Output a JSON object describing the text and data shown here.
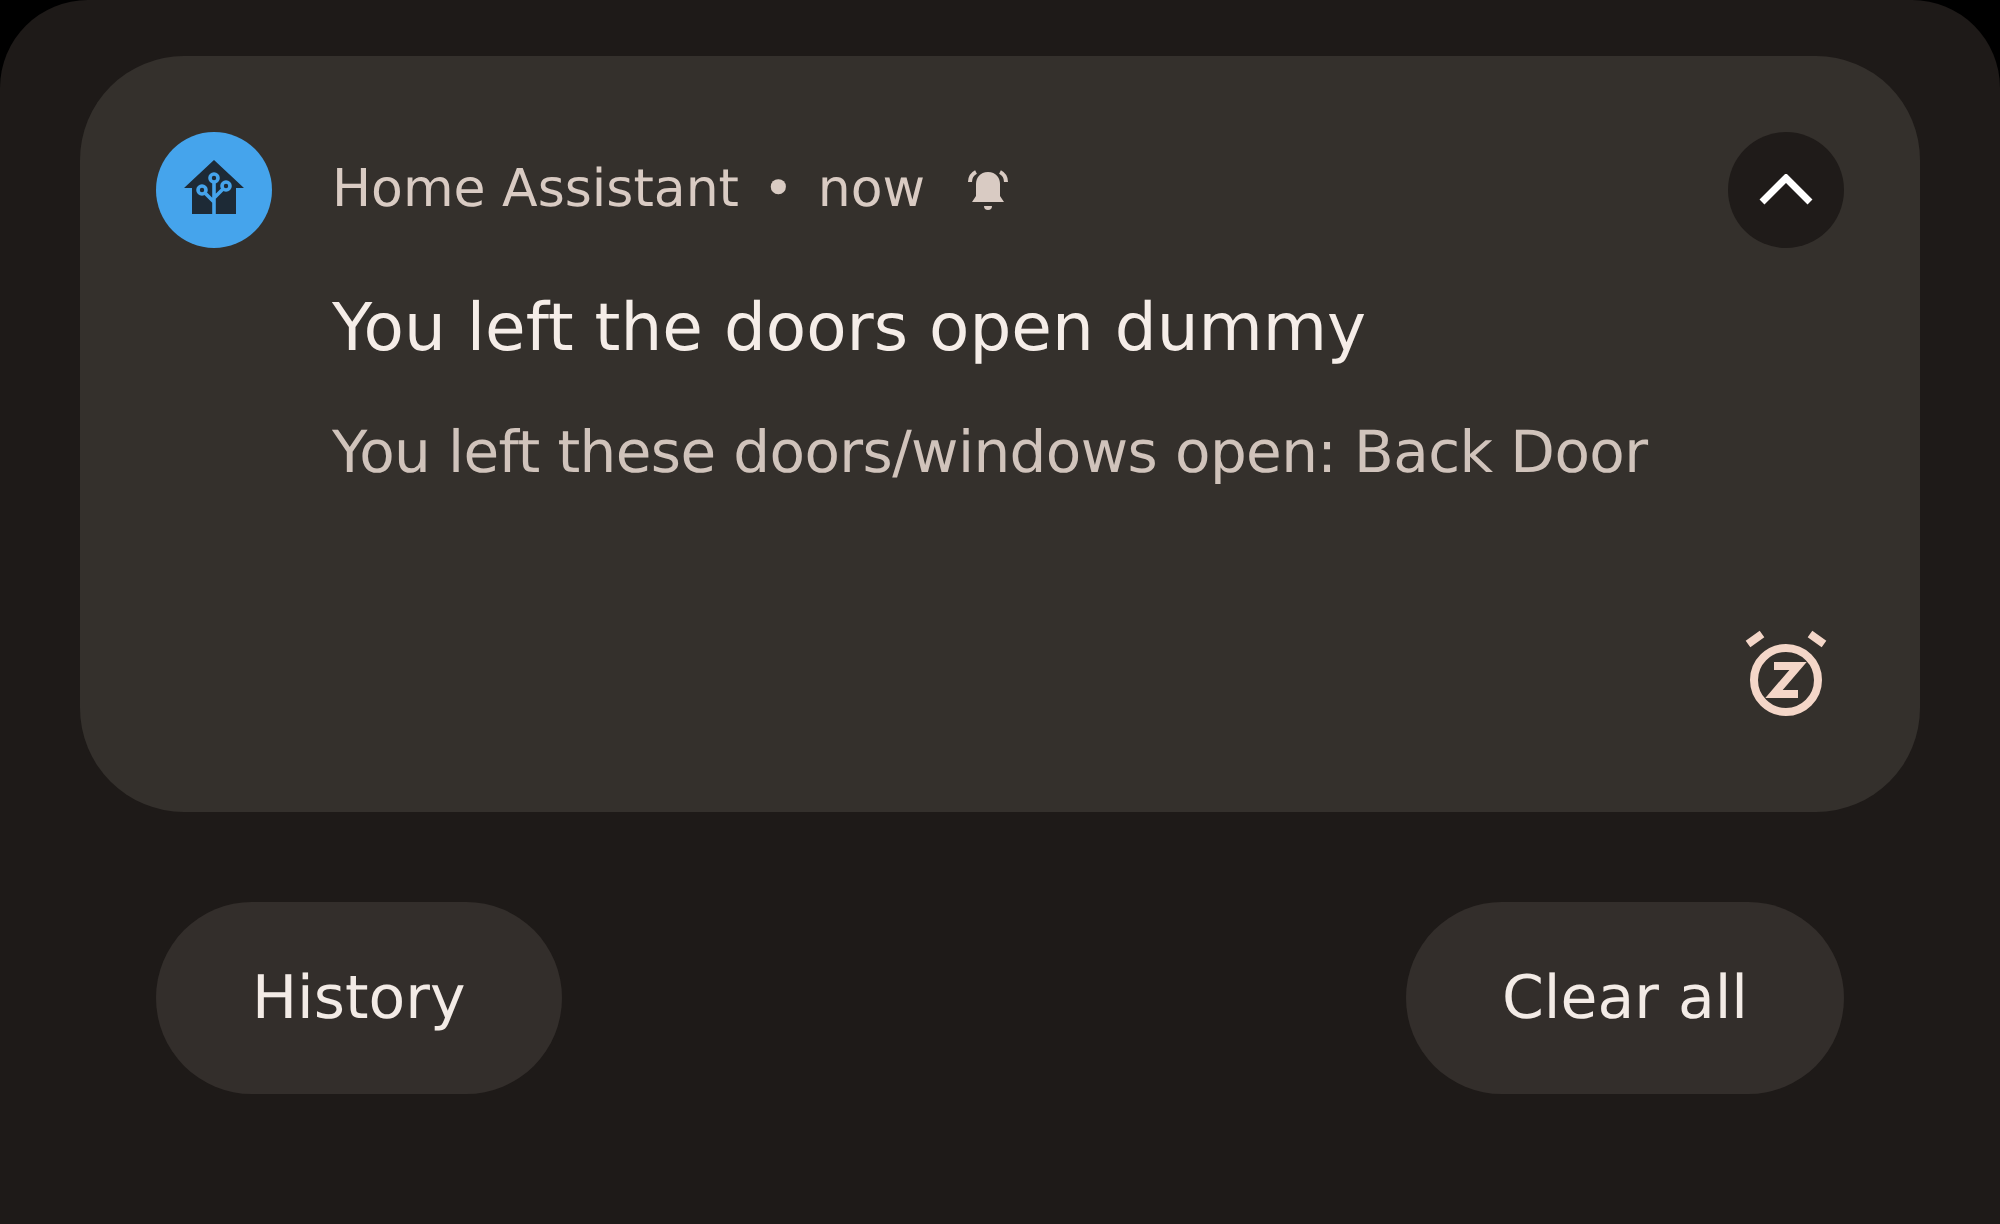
{
  "notification": {
    "app": "Home Assistant",
    "separator": "•",
    "time": "now",
    "alerting": true,
    "expanded": true,
    "title": "You left the doors open dummy",
    "body": "You left these doors/windows open: Back Door"
  },
  "buttons": [
    {
      "label": "History"
    },
    {
      "label": "Clear all"
    }
  ]
}
